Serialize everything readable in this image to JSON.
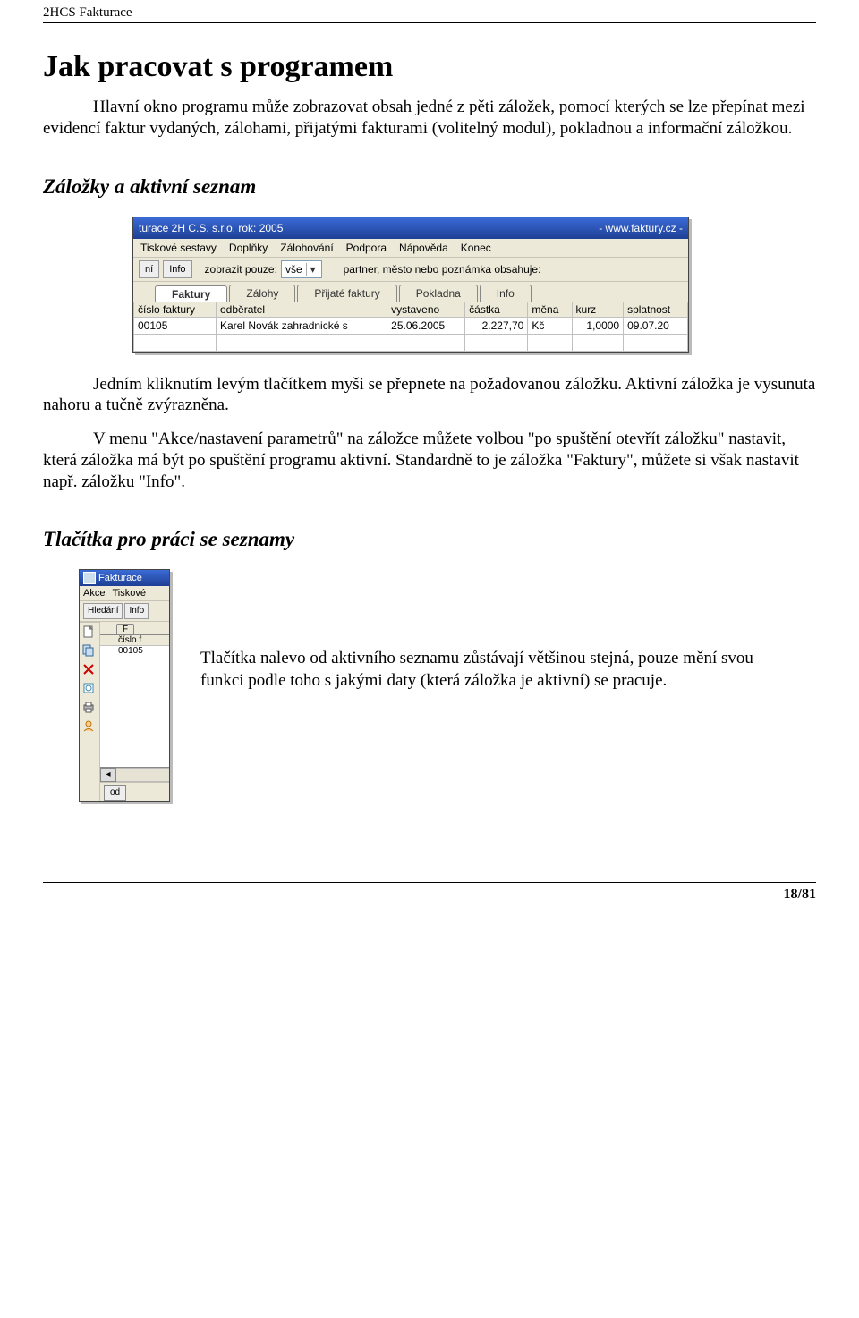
{
  "header": "2HCS Fakturace",
  "h1": "Jak pracovat s programem",
  "intro": "Hlavní okno programu může zobrazovat obsah jedné z pěti záložek, pomocí kterých se lze přepínat mezi evidencí faktur vydaných, zálohami, přijatými fakturami (volitelný modul), pokladnou a informační záložkou.",
  "h2a": "Záložky a aktivní seznam",
  "para_a1": "Jedním kliknutím levým tlačítkem myši se přepnete na požadovanou záložku. Aktivní záložka je vysunuta nahoru a tučně zvýrazněna.",
  "para_a2": "V menu \"Akce/nastavení parametrů\" na záložce můžete volbou \"po spuštění otevřít záložku\" nastavit, která záložka má být po spuštění programu aktivní. Standardně to je záložka \"Faktury\", můžete si však nastavit např. záložku \"Info\".",
  "h2b": "Tlačítka pro práci se seznamy",
  "side_text": "Tlačítka nalevo od aktivního seznamu zůstávají většinou stejná, pouze mění svou funkci podle toho s jakými daty (která záložka je aktivní) se pracuje.",
  "footer": "18/81",
  "win1": {
    "title_left": "turace 2H C.S. s.r.o.   rok: 2005",
    "title_right": "- www.faktury.cz -",
    "menu": [
      "Tiskové sestavy",
      "Doplňky",
      "Zálohování",
      "Podpora",
      "Nápověda",
      "Konec"
    ],
    "toolbar": {
      "btn1": "ní",
      "btn2": "Info",
      "label_show": "zobrazit pouze:",
      "combo_value": "vše",
      "label_filter": "partner, město nebo poznámka obsahuje:"
    },
    "tabs": [
      "Faktury",
      "Zálohy",
      "Přijaté faktury",
      "Pokladna",
      "Info"
    ],
    "columns": [
      "číslo faktury",
      "odběratel",
      "vystaveno",
      "částka",
      "měna",
      "kurz",
      "splatnost"
    ],
    "row": {
      "cislo": "00105",
      "odberatel": "Karel Novák zahradnické s",
      "vystaveno": "25.06.2005",
      "castka": "2.227,70",
      "mena": "Kč",
      "kurz": "1,0000",
      "splatnost": "09.07.20"
    }
  },
  "win2": {
    "title": "Fakturace",
    "menu": [
      "Akce",
      "Tiskové"
    ],
    "btns": [
      "Hledání",
      "Info"
    ],
    "tab": "F",
    "col": "číslo f",
    "cell": "00105",
    "bottom": "od"
  }
}
